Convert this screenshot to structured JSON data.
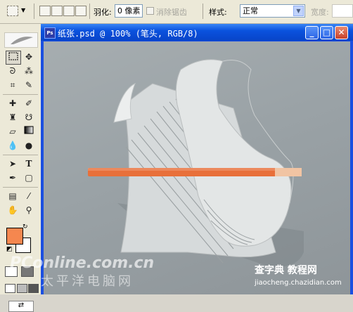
{
  "options_bar": {
    "feather_label": "羽化:",
    "feather_value": "0 像素",
    "antialias_label": "消除锯齿",
    "style_label": "样式:",
    "style_value": "正常",
    "width_label": "宽度:"
  },
  "document": {
    "title": "纸张.psd @ 100% (笔头, RGB/8)"
  },
  "colors": {
    "foreground": "#f5874f",
    "background": "#ffffff",
    "pencil": "#e8703a",
    "pencil_tip": "#f1c4a3"
  },
  "watermarks": {
    "left": "PConline.com.cn",
    "left_sub": "太平洋电脑网",
    "right": "查字典 教程网",
    "right_url": "jiaocheng.chazidian.com"
  }
}
